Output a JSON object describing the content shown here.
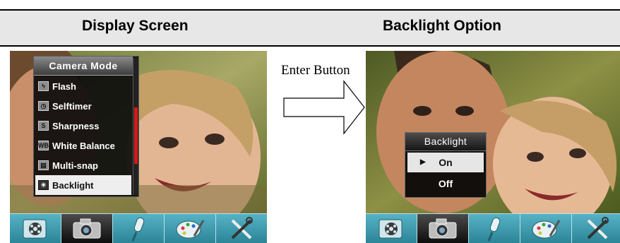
{
  "header": {
    "left_title": "Display Screen",
    "right_title": "Backlight Option"
  },
  "camera_menu": {
    "title": "Camera Mode",
    "items": [
      {
        "label": "Flash",
        "icon": "flash-icon",
        "glyph": "ϟ"
      },
      {
        "label": "Selftimer",
        "icon": "selftimer-icon",
        "glyph": "◷"
      },
      {
        "label": "Sharpness",
        "icon": "sharpness-icon",
        "glyph": "S"
      },
      {
        "label": "White Balance",
        "icon": "white-balance-icon",
        "glyph": "WB"
      },
      {
        "label": "Multi-snap",
        "icon": "multi-snap-icon",
        "glyph": "▤"
      },
      {
        "label": "Backlight",
        "icon": "backlight-icon",
        "glyph": "☀",
        "selected": true
      }
    ]
  },
  "transition": {
    "label": "Enter Button"
  },
  "backlight_popup": {
    "title": "Backlight",
    "options": [
      {
        "label": "On",
        "selected": true
      },
      {
        "label": "Off",
        "selected": false
      }
    ]
  },
  "dock_icons": [
    "video-reel-icon",
    "camera-icon",
    "microphone-icon",
    "palette-icon",
    "tools-icon"
  ],
  "colors": {
    "header_bg": "#e7e7e7",
    "dock_teal": "#2b8597",
    "scroll_thumb": "#d21b1b",
    "menu_bg": "#0c0c0c"
  }
}
